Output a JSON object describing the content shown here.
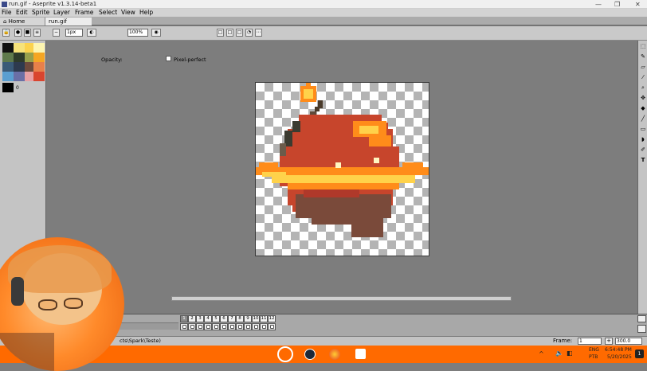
{
  "window": {
    "title": "run.gif - Aseprite v1.3.14-beta1",
    "minimize": "—",
    "maximize": "❐",
    "close": "✕"
  },
  "menu": [
    "File",
    "Edit",
    "Sprite",
    "Layer",
    "Frame",
    "Select",
    "View",
    "Help"
  ],
  "tabs": [
    {
      "label": "Home"
    },
    {
      "label": "run.gif"
    }
  ],
  "toolbar": {
    "brush_size": "1px",
    "opacity_label": "Opacity:",
    "opacity_value": "100%",
    "pixel_perfect_label": "Pixel-perfect"
  },
  "palette": {
    "colors": [
      "#111111",
      "#f6e27a",
      "#fbd24d",
      "#fdf5b0",
      "#5f7a4c",
      "#2e3b2a",
      "#97a04c",
      "#f5a623",
      "#3a5a77",
      "#2d3a4e",
      "#6e4a3c",
      "#e8804a",
      "#5a9fd1",
      "#6a6fa6",
      "#e7a0a5",
      "#d9452f",
      "#000000"
    ],
    "count_label": "0"
  },
  "tools": [
    "marquee-icon",
    "pencil-icon",
    "eraser-icon",
    "eyedropper-icon",
    "zoom-icon",
    "move-icon",
    "paint-bucket-icon",
    "line-icon",
    "rectangle-icon",
    "blur-icon",
    "contour-icon",
    "text-icon"
  ],
  "sprite": {
    "name": "bomb-planet sprite"
  },
  "timeline": {
    "frames": [
      "1",
      "2",
      "3",
      "4",
      "5",
      "6",
      "7",
      "8",
      "9",
      "10",
      "11",
      "12"
    ],
    "current_frame": "1"
  },
  "statusbar": {
    "path": "cts\\Spark\\Teste)",
    "frame_label": "Frame:",
    "frame_value": "1",
    "zoom_value": "300.0"
  },
  "taskbar": {
    "lang1": "ENG",
    "lang2": "PTB",
    "time": "6:54:48 PM",
    "date": "5/20/2025",
    "notif_count": "1"
  },
  "colors": {
    "accent": "#ff6a00",
    "canvas_bg": "#7d7d7d",
    "panel": "#c4c4c4"
  }
}
